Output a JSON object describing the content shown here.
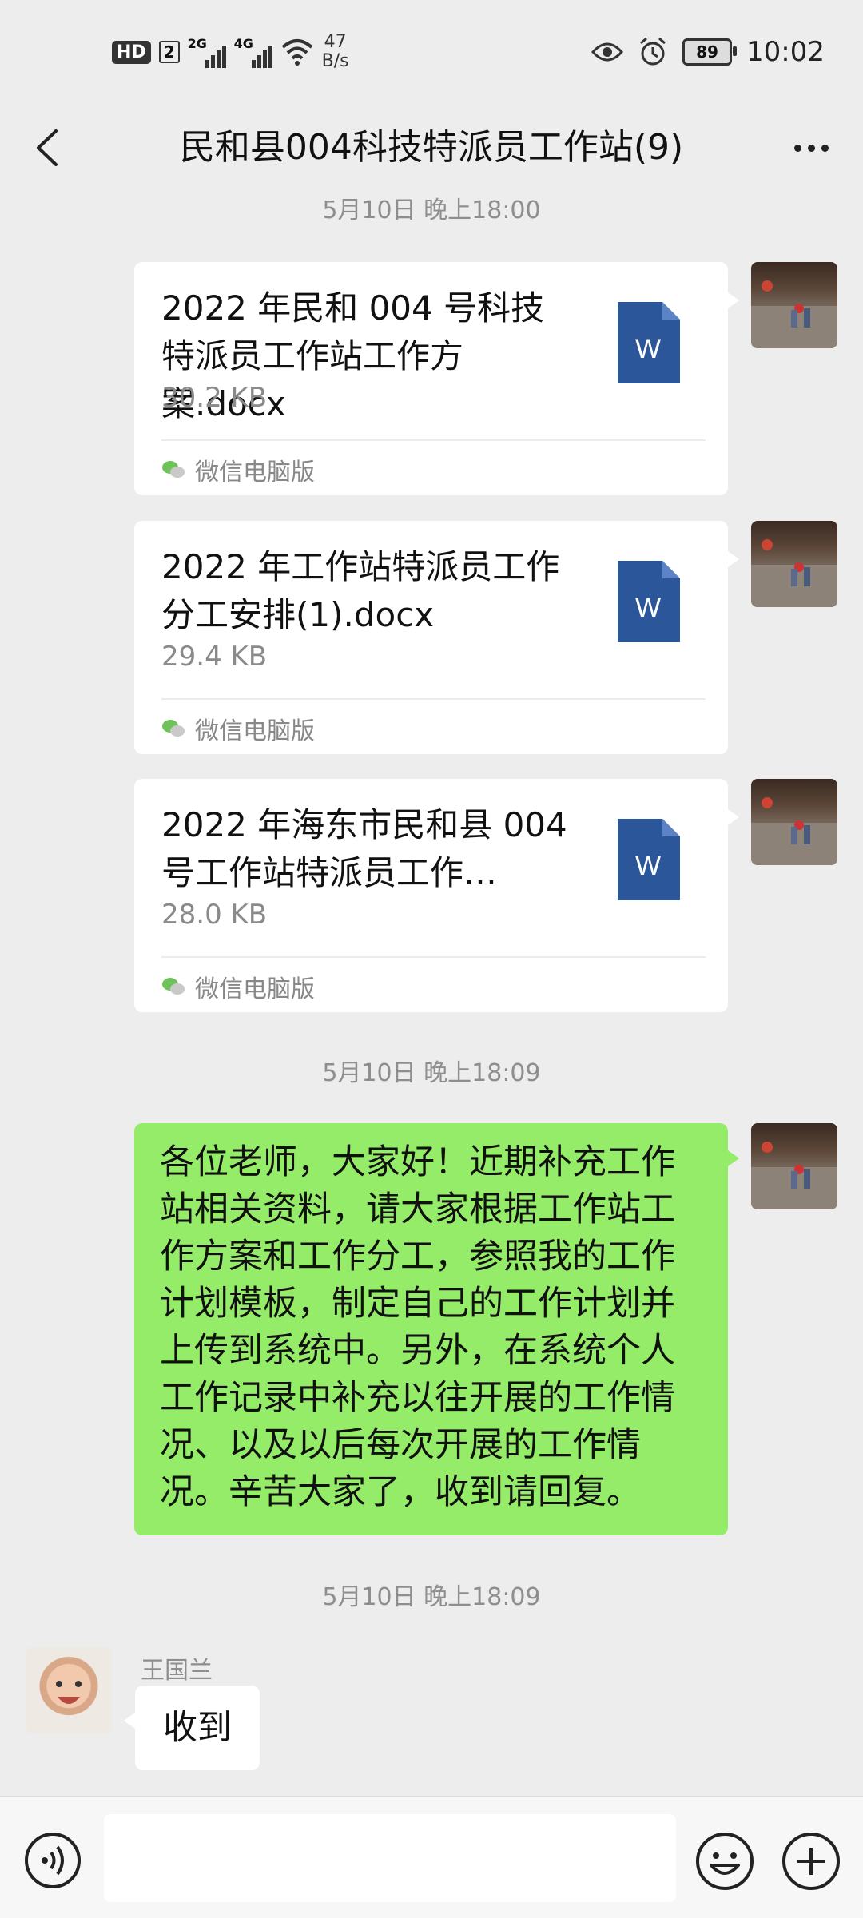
{
  "status_bar": {
    "hd": "HD",
    "sim": "2",
    "net1": "2G",
    "net2": "4G",
    "speed_value": "47",
    "speed_unit": "B/s",
    "battery": "89",
    "time": "10:02"
  },
  "header": {
    "title": "民和县004科技特派员工作站(9)"
  },
  "messages": {
    "time1": "5月10日 晚上18:00",
    "time2": "5月10日 晚上18:09",
    "time3": "5月10日 晚上18:09",
    "files": [
      {
        "name": "2022 年民和 004 号科技特派员工作站工作方案.docx",
        "size": "30.2 KB",
        "source": "微信电脑版",
        "icon_letter": "W"
      },
      {
        "name": "2022 年工作站特派员工作分工安排(1).docx",
        "size": "29.4 KB",
        "source": "微信电脑版",
        "icon_letter": "W"
      },
      {
        "name": "2022 年海东市民和县 004 号工作站特派员工作…",
        "size": "28.0 KB",
        "source": "微信电脑版",
        "icon_letter": "W"
      }
    ],
    "text_message": "各位老师，大家好！近期补充工作站相关资料，请大家根据工作站工作方案和工作分工，参照我的工作计划模板，制定自己的工作计划并上传到系统中。另外，在系统个人工作记录中补充以往开展的工作情况、以及以后每次开展的工作情况。辛苦大家了，收到请回复。",
    "reply_sender": "王国兰",
    "reply_text": "收到"
  },
  "input_bar": {
    "icons": [
      "voice-icon",
      "emoji-icon",
      "plus-icon"
    ],
    "value": ""
  },
  "colors": {
    "background": "#ededed",
    "green_bubble": "#95ec69",
    "word_icon": "#2b579a",
    "muted_text": "#8e8e8e"
  }
}
